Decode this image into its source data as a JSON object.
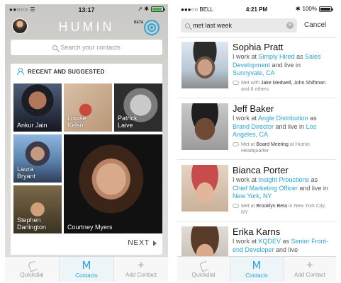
{
  "left_phone": {
    "status": {
      "signal": "●●○○○ ☰",
      "time": "13:17",
      "right": "➚ ✱"
    },
    "logo": "HUMIN",
    "beta": "BETA",
    "search_placeholder": "Search your contacts",
    "section_title": "RECENT AND SUGGESTED",
    "contacts": [
      {
        "first": "Ankur",
        "last": "Jain"
      },
      {
        "first": "Louise",
        "last": "Kelso"
      },
      {
        "first": "Patrick",
        "last": "Laive"
      },
      {
        "first": "Laura",
        "last": "Bryant"
      },
      {
        "first": "Courtney",
        "last": "Myers"
      },
      {
        "first": "Stephen",
        "last": "Darlington"
      }
    ],
    "next_label": "NEXT",
    "tabs": [
      {
        "label": "Quickdial",
        "icon": "phone-icon"
      },
      {
        "label": "Contacts",
        "icon": "contacts-m-icon"
      },
      {
        "label": "Add Contact",
        "icon": "plus-icon"
      }
    ]
  },
  "right_phone": {
    "status": {
      "carrier": "●●●○○ BELL",
      "time": "4:21 PM",
      "battery_text": "100%"
    },
    "search_query": "met last week",
    "cancel_label": "Cancel",
    "results": [
      {
        "name": "Sophia Pratt",
        "work_prefix": "I work at ",
        "company": "Simply Hired",
        "as": " as ",
        "role": "Sales Development",
        "live": " and live in ",
        "city": "Sunnyvale, CA",
        "met_prefix": "Met with ",
        "met_detail": "Jake Medwell, John Shiftman",
        "met_suffix": " and 6 others"
      },
      {
        "name": "Jeff Baker",
        "work_prefix": "I work at ",
        "company": "Angle Distribution",
        "as": " as ",
        "role": "Brand Director",
        "live": " and live in ",
        "city": "Los Angeles, CA",
        "met_prefix": "Met at ",
        "met_detail": "Board Meeting",
        "met_suffix": " at Humin Headquarter"
      },
      {
        "name": "Bianca Porter",
        "work_prefix": "I work at ",
        "company": "Insight Prouctions",
        "as": " as ",
        "role": "Chief Marketing Officer",
        "live": " and live in ",
        "city": "New York, NY",
        "met_prefix": "Met at ",
        "met_detail": "Brooklyn Beta",
        "met_suffix": " in New York City, NY"
      },
      {
        "name": "Erika Karns",
        "work_prefix": "I work at ",
        "company": "KQDEV",
        "as": " as ",
        "role": "Senior Front-end Developer",
        "live": " and live",
        "city": "",
        "met_prefix": "",
        "met_detail": "",
        "met_suffix": ""
      }
    ],
    "tabs": [
      {
        "label": "Quickdial",
        "icon": "phone-icon"
      },
      {
        "label": "Contacts",
        "icon": "contacts-m-icon"
      },
      {
        "label": "Add Contact",
        "icon": "plus-icon"
      }
    ]
  },
  "colors": {
    "accent": "#2aa6d9",
    "battery_green": "#39b54a"
  }
}
